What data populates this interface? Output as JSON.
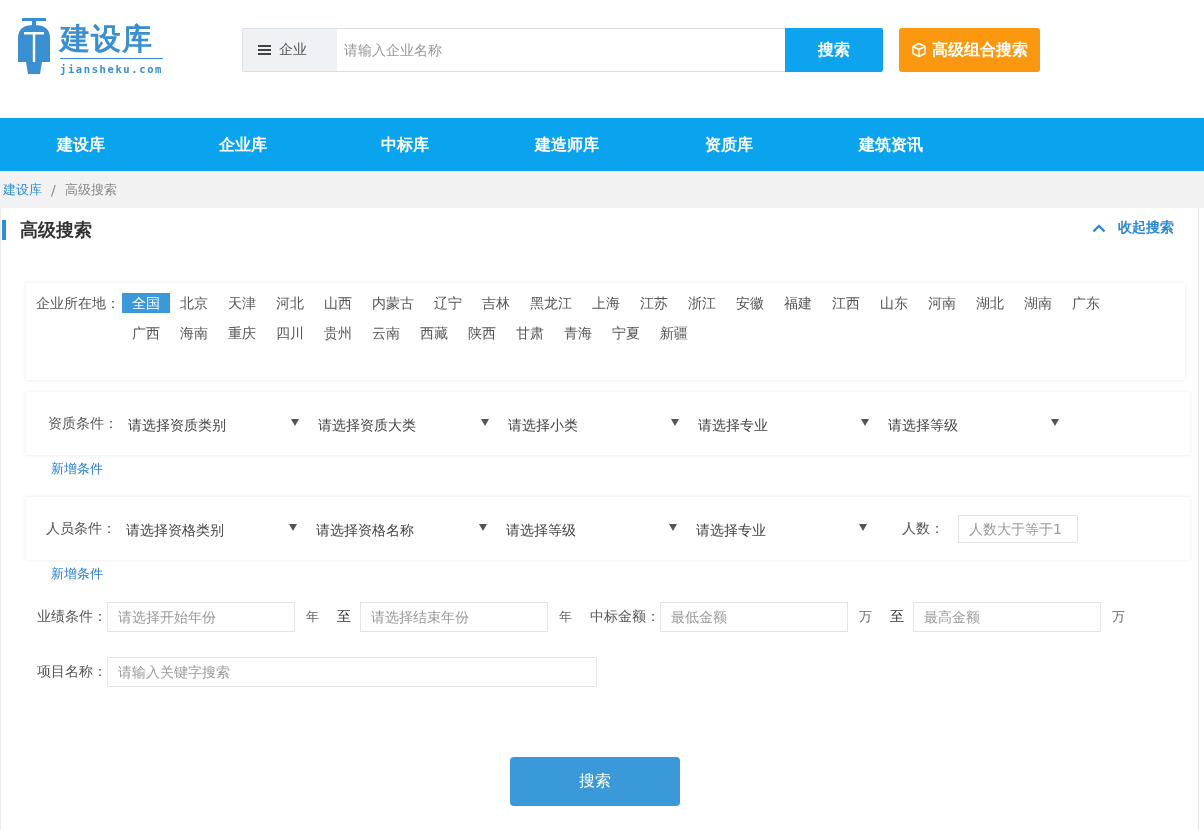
{
  "header": {
    "logo": {
      "name": "建设库",
      "domain": "jiansheku.com"
    },
    "search": {
      "category": "企业",
      "placeholder": "请输入企业名称",
      "button": "搜索"
    },
    "advanced_button": "高级组合搜索"
  },
  "nav": {
    "items": [
      "建设库",
      "企业库",
      "中标库",
      "建造师库",
      "资质库",
      "建筑资讯"
    ]
  },
  "breadcrumb": {
    "separator": "/",
    "items": [
      {
        "label": "建设库",
        "kind": "link"
      },
      {
        "label": "高级搜索",
        "kind": "current"
      }
    ]
  },
  "panel": {
    "title": "高级搜索",
    "collapse_link": "收起搜索",
    "location": {
      "label": "企业所在地：",
      "regions": [
        {
          "label": "全国",
          "selected": true
        },
        {
          "label": "北京",
          "selected": false
        },
        {
          "label": "天津",
          "selected": false
        },
        {
          "label": "河北",
          "selected": false
        },
        {
          "label": "山西",
          "selected": false
        },
        {
          "label": "内蒙古",
          "selected": false
        },
        {
          "label": "辽宁",
          "selected": false
        },
        {
          "label": "吉林",
          "selected": false
        },
        {
          "label": "黑龙江",
          "selected": false
        },
        {
          "label": "上海",
          "selected": false
        },
        {
          "label": "江苏",
          "selected": false
        },
        {
          "label": "浙江",
          "selected": false
        },
        {
          "label": "安徽",
          "selected": false
        },
        {
          "label": "福建",
          "selected": false
        },
        {
          "label": "江西",
          "selected": false
        },
        {
          "label": "山东",
          "selected": false
        },
        {
          "label": "河南",
          "selected": false
        },
        {
          "label": "湖北",
          "selected": false
        },
        {
          "label": "湖南",
          "selected": false
        },
        {
          "label": "广东",
          "selected": false
        },
        {
          "label": "广西",
          "selected": false
        },
        {
          "label": "海南",
          "selected": false
        },
        {
          "label": "重庆",
          "selected": false
        },
        {
          "label": "四川",
          "selected": false
        },
        {
          "label": "贵州",
          "selected": false
        },
        {
          "label": "云南",
          "selected": false
        },
        {
          "label": "西藏",
          "selected": false
        },
        {
          "label": "陕西",
          "selected": false
        },
        {
          "label": "甘肃",
          "selected": false
        },
        {
          "label": "青海",
          "selected": false
        },
        {
          "label": "宁夏",
          "selected": false
        },
        {
          "label": "新疆",
          "selected": false
        }
      ]
    },
    "qualification": {
      "label": "资质条件：",
      "selects": [
        "请选择资质类别",
        "请选择资质大类",
        "请选择小类",
        "请选择专业",
        "请选择等级"
      ],
      "add_link": "新增条件"
    },
    "personnel": {
      "label": "人员条件：",
      "selects": [
        "请选择资格类别",
        "请选择资格名称",
        "请选择等级",
        "请选择专业"
      ],
      "count_label": "人数：",
      "count_placeholder": "人数大于等于1",
      "add_link": "新增条件"
    },
    "performance": {
      "items": [
        {
          "kind": "label",
          "text": "业绩条件："
        },
        {
          "kind": "input",
          "placeholder": "请选择开始年份"
        },
        {
          "kind": "unit",
          "text": "年"
        },
        {
          "kind": "separator",
          "text": "至"
        },
        {
          "kind": "input",
          "placeholder": "请选择结束年份"
        },
        {
          "kind": "unit",
          "text": "年"
        },
        {
          "kind": "label",
          "text": "中标金额："
        },
        {
          "kind": "input",
          "placeholder": "最低金额"
        },
        {
          "kind": "unit",
          "text": "万"
        },
        {
          "kind": "separator",
          "text": "至"
        },
        {
          "kind": "input",
          "placeholder": "最高金额"
        },
        {
          "kind": "unit",
          "text": "万"
        }
      ]
    },
    "project": {
      "label": "项目名称：",
      "placeholder": "请输入关键字搜索"
    },
    "submit": "搜索"
  }
}
